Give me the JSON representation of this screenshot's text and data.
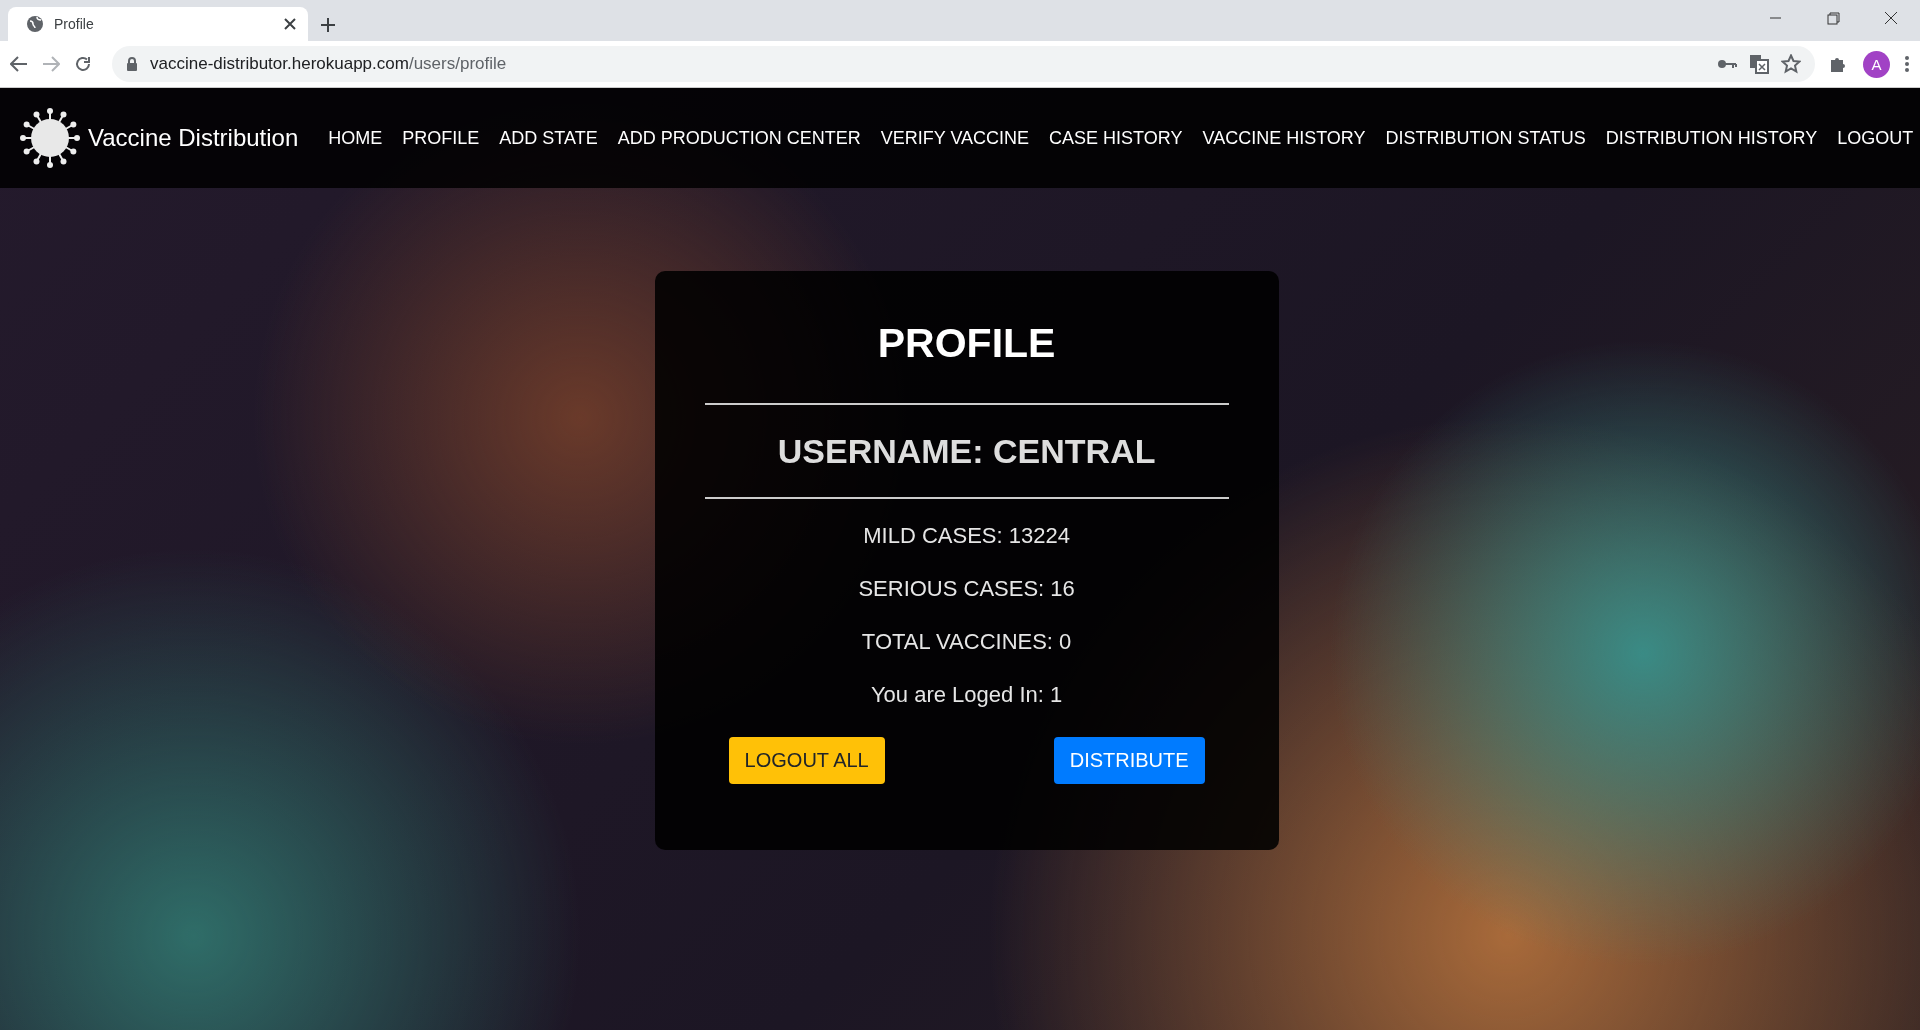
{
  "browser": {
    "tab_title": "Profile",
    "url_host": "vaccine-distributor.herokuapp.com",
    "url_path": "/users/profile",
    "avatar": "A"
  },
  "navbar": {
    "brand": "Vaccine Distribution",
    "links": [
      "HOME",
      "PROFILE",
      "ADD STATE",
      "ADD PRODUCTION CENTER",
      "VERIFY VACCINE",
      "CASE HISTORY",
      "VACCINE HISTORY",
      "DISTRIBUTION STATUS",
      "DISTRIBUTION HISTORY",
      "LOGOUT"
    ]
  },
  "card": {
    "title": "PROFILE",
    "username": "USERNAME: CENTRAL",
    "stats": [
      "MILD CASES: 13224",
      "SERIOUS CASES: 16",
      "TOTAL VACCINES: 0",
      "You are Loged In: 1"
    ],
    "buttons": [
      {
        "label": "LOGOUT ALL",
        "kind": "warning"
      },
      {
        "label": "DISTRIBUTE",
        "kind": "primary"
      }
    ]
  }
}
